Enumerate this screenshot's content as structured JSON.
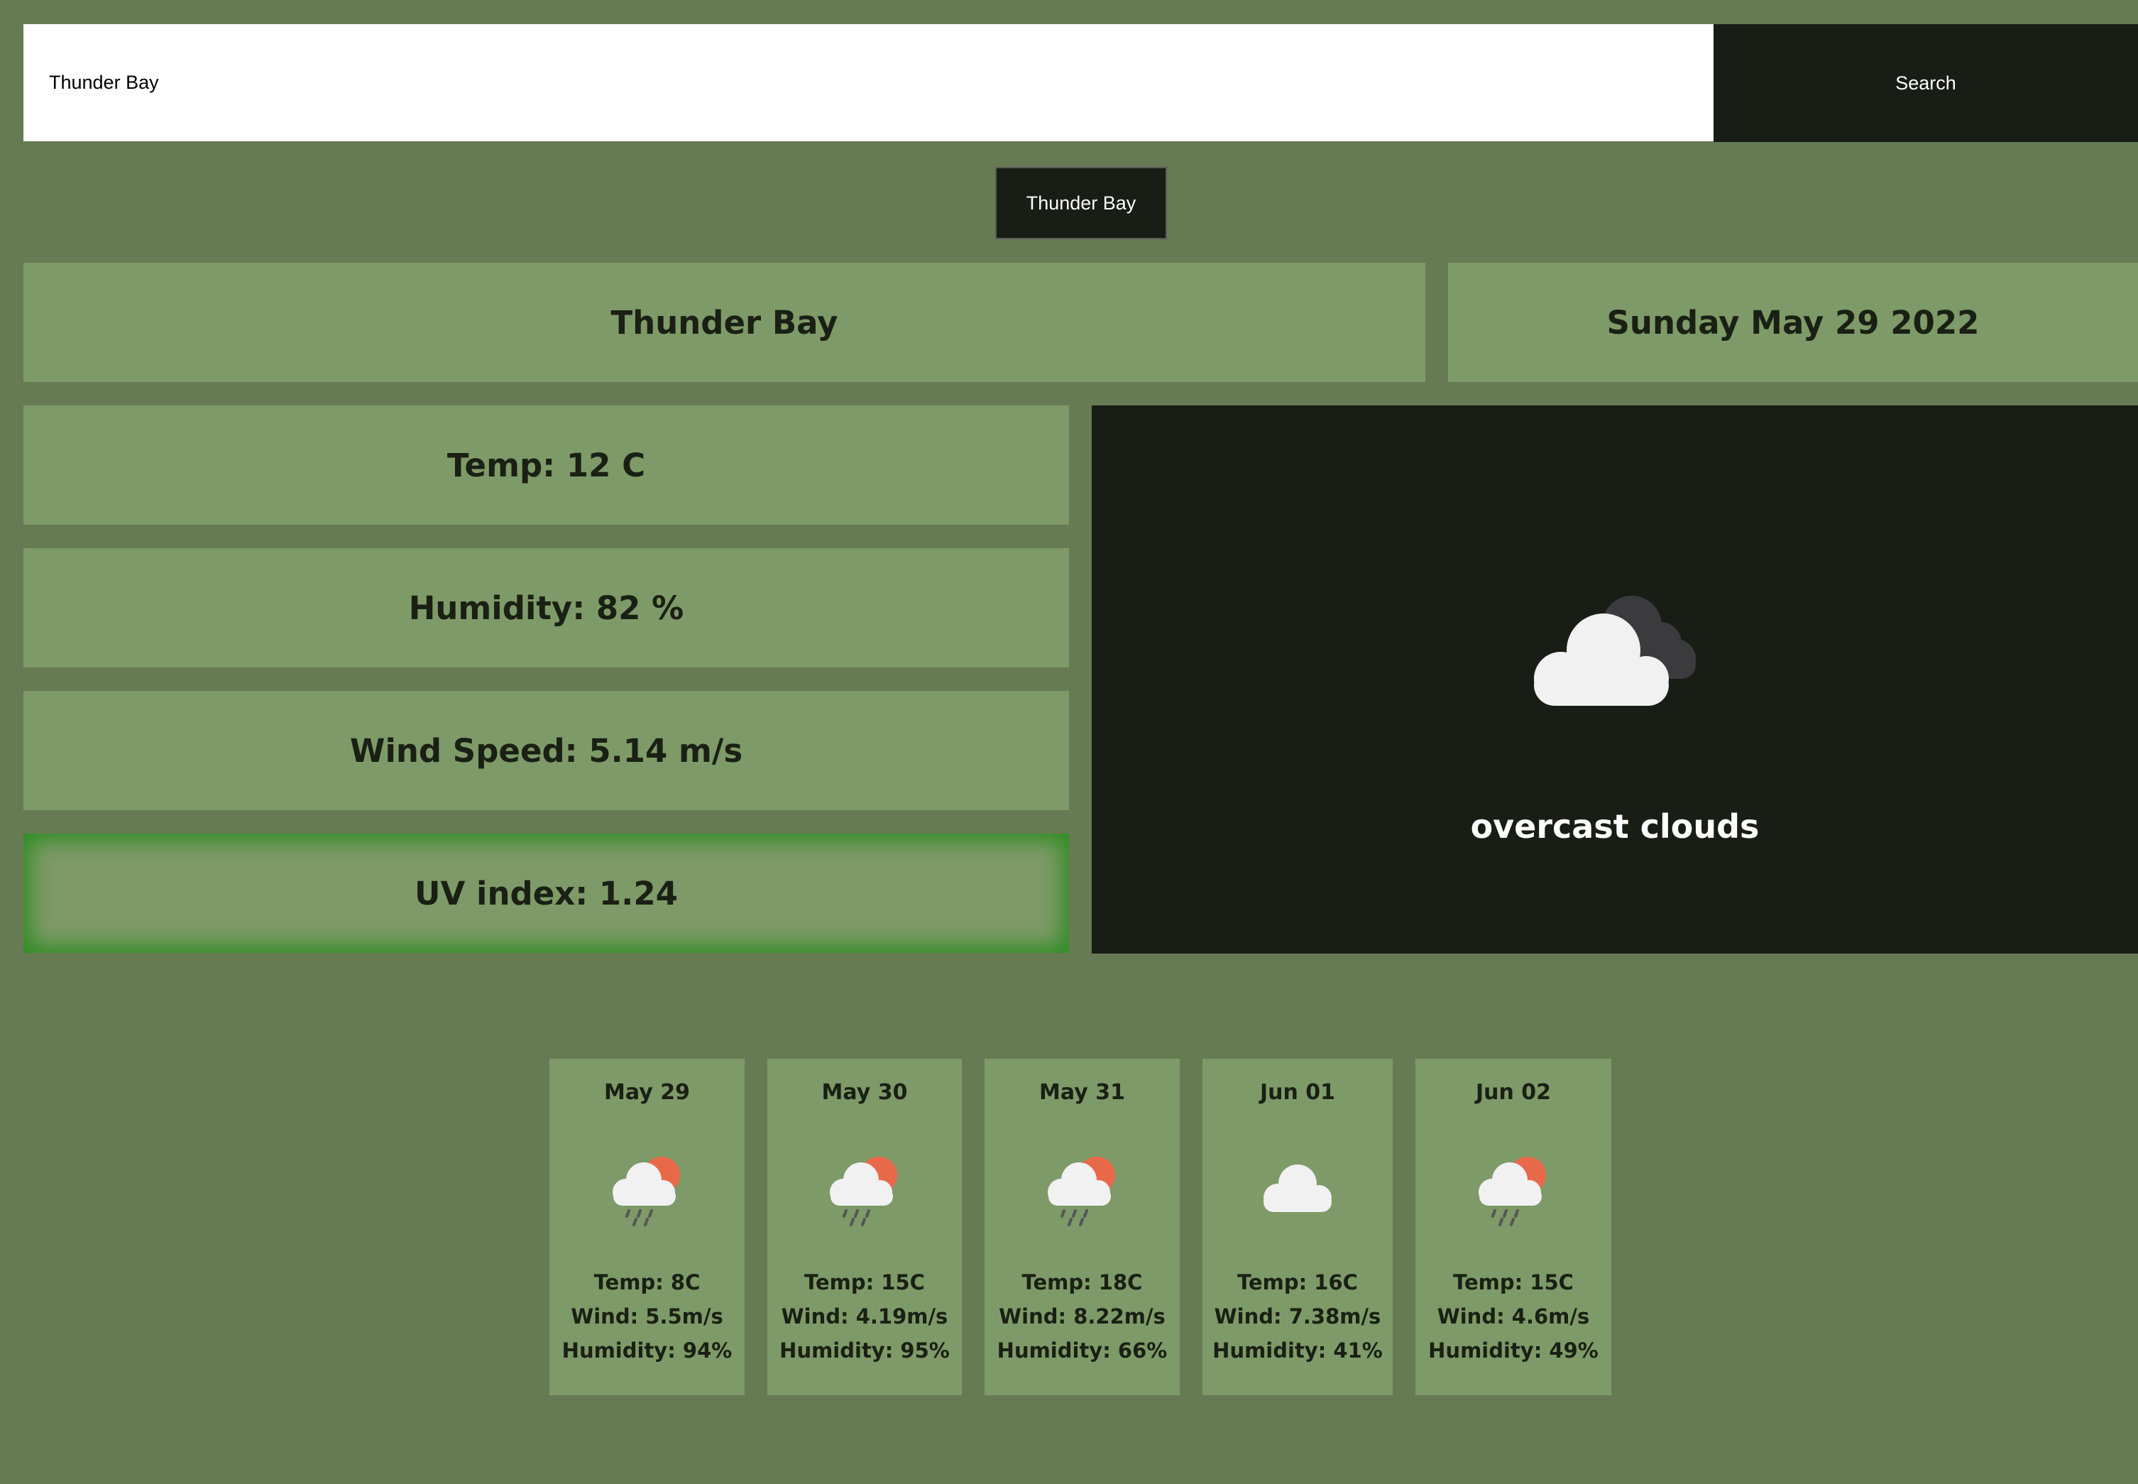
{
  "search": {
    "value": "Thunder Bay",
    "button_label": "Search"
  },
  "history": [
    "Thunder Bay"
  ],
  "current": {
    "city": "Thunder Bay",
    "date": "Sunday May 29 2022",
    "temp": "Temp: 12 C",
    "humidity": "Humidity: 82 %",
    "wind": "Wind Speed: 5.14 m/s",
    "uv": "UV index: 1.24",
    "description": "overcast clouds",
    "icon": "overcast-clouds-icon"
  },
  "forecast": [
    {
      "date": "May 29",
      "icon": "sun-cloud-rain-icon",
      "temp": "Temp: 8C",
      "wind": "Wind: 5.5m/s",
      "humidity": "Humidity: 94%"
    },
    {
      "date": "May 30",
      "icon": "sun-cloud-rain-icon",
      "temp": "Temp: 15C",
      "wind": "Wind: 4.19m/s",
      "humidity": "Humidity: 95%"
    },
    {
      "date": "May 31",
      "icon": "sun-cloud-rain-icon",
      "temp": "Temp: 18C",
      "wind": "Wind: 8.22m/s",
      "humidity": "Humidity: 66%"
    },
    {
      "date": "Jun 01",
      "icon": "cloud-icon",
      "temp": "Temp: 16C",
      "wind": "Wind: 7.38m/s",
      "humidity": "Humidity: 41%"
    },
    {
      "date": "Jun 02",
      "icon": "sun-cloud-rain-icon",
      "temp": "Temp: 15C",
      "wind": "Wind: 4.6m/s",
      "humidity": "Humidity: 49%"
    }
  ],
  "colors": {
    "background": "#667b53",
    "panel": "#7e9a68",
    "dark": "#181d15",
    "uv_glow": "#2f8c22",
    "sun": "#e8694a"
  }
}
